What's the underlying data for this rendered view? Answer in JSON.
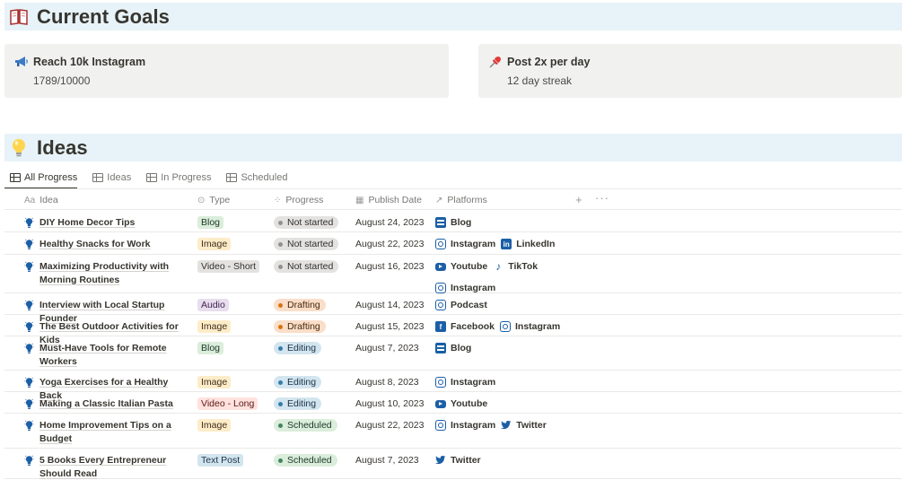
{
  "goals_section": {
    "title": "Current Goals",
    "icon": "book-icon",
    "goals": [
      {
        "title": "Reach 10k Instagram",
        "value": "1789/10000",
        "icon": "megaphone-icon"
      },
      {
        "title": "Post 2x per day",
        "value": "12 day streak",
        "icon": "pushpin-icon"
      }
    ]
  },
  "ideas_section": {
    "title": "Ideas",
    "icon": "lightbulb-icon"
  },
  "tabs": [
    "All Progress",
    "Ideas",
    "In Progress",
    "Scheduled"
  ],
  "columns": {
    "idea": "Idea",
    "type": "Type",
    "progress": "Progress",
    "date": "Publish Date",
    "platforms": "Platforms"
  },
  "type_colors": {
    "Blog": {
      "bg": "#dbeddb",
      "fg": "#1c3829"
    },
    "Image": {
      "bg": "#fdecc8",
      "fg": "#402c1b"
    },
    "Video - Short": {
      "bg": "#e3e2e0",
      "fg": "#32302c"
    },
    "Audio": {
      "bg": "#e8deee",
      "fg": "#412454"
    },
    "Video - Long": {
      "bg": "#ffe2dd",
      "fg": "#5d1715"
    },
    "Text Post": {
      "bg": "#d3e5ef",
      "fg": "#183347"
    }
  },
  "status_colors": {
    "Not started": {
      "bg": "#e3e2e0",
      "fg": "#32302c",
      "dot": "#91918e"
    },
    "Drafting": {
      "bg": "#fadec9",
      "fg": "#49290e",
      "dot": "#d9730d"
    },
    "Editing": {
      "bg": "#d3e5ef",
      "fg": "#183347",
      "dot": "#337ea9"
    },
    "Scheduled": {
      "bg": "#dbeddb",
      "fg": "#1c3829",
      "dot": "#448361"
    }
  },
  "rows": [
    {
      "idea": "DIY Home Decor Tips",
      "type": "Blog",
      "progress": "Not started",
      "date": "August 24, 2023",
      "platforms": [
        {
          "name": "Blog",
          "icon": "blog"
        }
      ]
    },
    {
      "idea": "Healthy Snacks for Work",
      "type": "Image",
      "progress": "Not started",
      "date": "August 22, 2023",
      "platforms": [
        {
          "name": "Instagram",
          "icon": "instagram"
        },
        {
          "name": "LinkedIn",
          "icon": "linkedin"
        }
      ]
    },
    {
      "idea": "Maximizing Productivity with Morning Routines",
      "type": "Video - Short",
      "progress": "Not started",
      "date": "August 16, 2023",
      "platforms": [
        {
          "name": "Youtube",
          "icon": "youtube"
        },
        {
          "name": "TikTok",
          "icon": "tiktok"
        },
        {
          "name": "Instagram",
          "icon": "instagram"
        }
      ]
    },
    {
      "idea": "Interview with Local Startup Founder",
      "type": "Audio",
      "progress": "Drafting",
      "date": "August 14, 2023",
      "platforms": [
        {
          "name": "Podcast",
          "icon": "podcast"
        }
      ]
    },
    {
      "idea": "The Best Outdoor Activities for Kids",
      "type": "Image",
      "progress": "Drafting",
      "date": "August 15, 2023",
      "platforms": [
        {
          "name": "Facebook",
          "icon": "facebook"
        },
        {
          "name": "Instagram",
          "icon": "instagram"
        }
      ]
    },
    {
      "idea": "Must-Have Tools for Remote Workers",
      "type": "Blog",
      "progress": "Editing",
      "date": "August 7, 2023",
      "platforms": [
        {
          "name": "Blog",
          "icon": "blog"
        }
      ]
    },
    {
      "idea": "Yoga Exercises for a Healthy Back",
      "type": "Image",
      "progress": "Editing",
      "date": "August 8, 2023",
      "platforms": [
        {
          "name": "Instagram",
          "icon": "instagram"
        }
      ]
    },
    {
      "idea": "Making a Classic Italian Pasta",
      "type": "Video - Long",
      "progress": "Editing",
      "date": "August 10, 2023",
      "platforms": [
        {
          "name": "Youtube",
          "icon": "youtube"
        }
      ]
    },
    {
      "idea": "Home Improvement Tips on a Budget",
      "type": "Image",
      "progress": "Scheduled",
      "date": "August 22, 2023",
      "platforms": [
        {
          "name": "Instagram",
          "icon": "instagram"
        },
        {
          "name": "Twitter",
          "icon": "twitter"
        }
      ]
    },
    {
      "idea": "5 Books Every Entrepreneur Should Read",
      "type": "Text Post",
      "progress": "Scheduled",
      "date": "August 7, 2023",
      "platforms": [
        {
          "name": "Twitter",
          "icon": "twitter"
        }
      ]
    }
  ]
}
